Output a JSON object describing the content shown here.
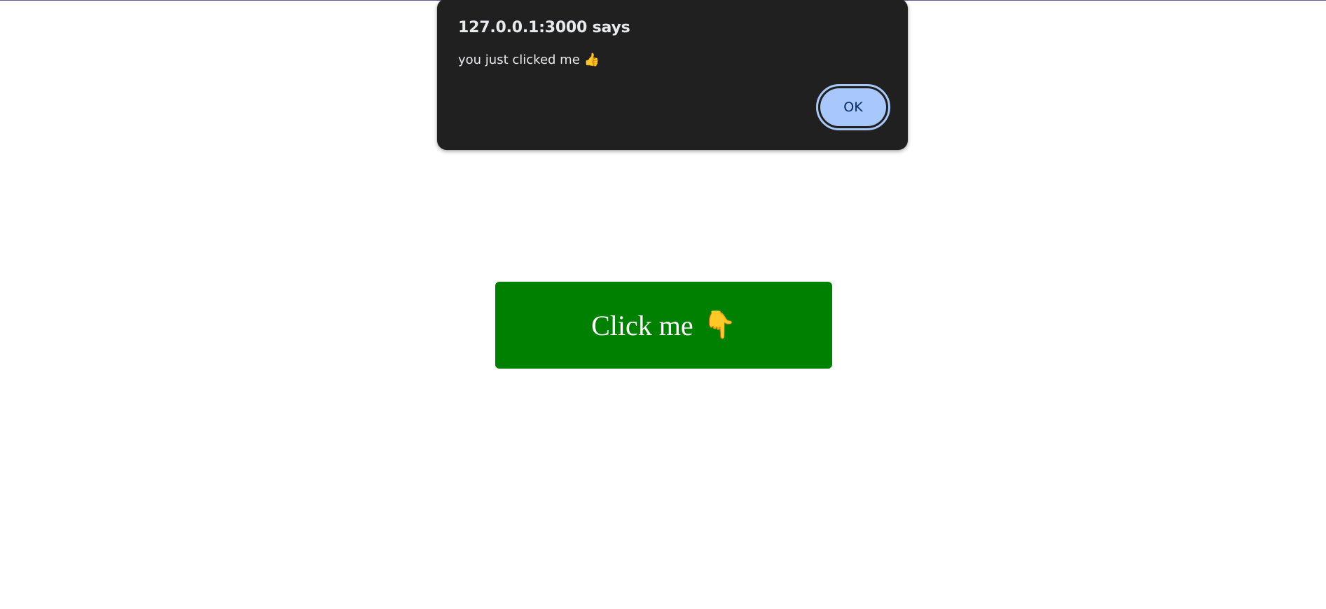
{
  "alert": {
    "title": "127.0.0.1:3000 says",
    "message": "you just clicked me",
    "message_icon": "thumbs-up-icon",
    "message_emoji": "👍",
    "ok_label": "OK",
    "ok_color": "#a8c7fa",
    "background_color": "#202020"
  },
  "main": {
    "button_label": "Click me",
    "button_icon": "pointing-down-icon",
    "button_emoji": "👇",
    "button_color": "#008000"
  }
}
